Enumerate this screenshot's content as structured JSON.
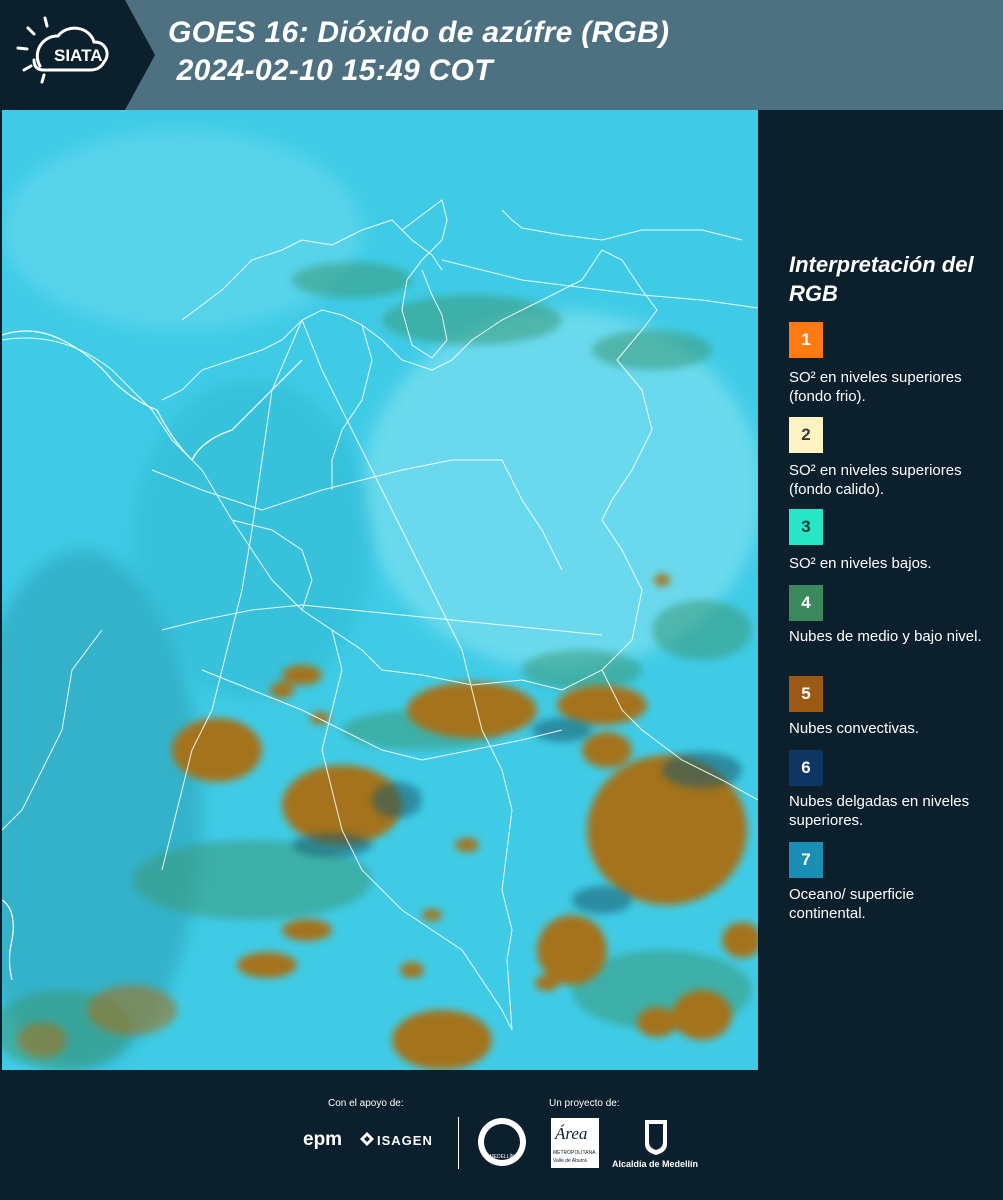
{
  "header": {
    "logo_text": "SIATA",
    "title": "GOES 16: Dióxido de azúfre (RGB)\n 2024-02-10 15:49 COT"
  },
  "map": {
    "description_icon": "satellite-rgb-map"
  },
  "legend": {
    "title": "Interpretación del RGB",
    "items": [
      {
        "number": "1",
        "label": "SO² en niveles superiores (fondo frio).",
        "color": "#ff7a12",
        "text_color": "#ffffff"
      },
      {
        "number": "2",
        "label": "SO² en niveles superiores (fondo calido).",
        "color": "#fdf3c2",
        "text_color": "#3a3a3a"
      },
      {
        "number": "3",
        "label": "SO² en niveles bajos.",
        "color": "#27e6c6",
        "text_color": "#0b3b3b"
      },
      {
        "number": "4",
        "label": "Nubes de medio y bajo nivel.",
        "color": "#3a8a5e",
        "text_color": "#ffffff"
      },
      {
        "number": "5",
        "label": "Nubes convectivas.",
        "color": "#9a5a16",
        "text_color": "#ffffff"
      },
      {
        "number": "6",
        "label": "Nubes delgadas en niveles superiores.",
        "color": "#0f3563",
        "text_color": "#ffffff"
      },
      {
        "number": "7",
        "label": "Oceano/ superficie continental.",
        "color": "#1a8fb5",
        "text_color": "#ffffff"
      }
    ]
  },
  "footer": {
    "support_label": "Con el apoyo de:",
    "project_label": "Un proyecto de:",
    "brand_epm": "epm",
    "brand_isagen": "ISAGEN",
    "brand_area_word": "Área",
    "brand_area_sub1": "METROPOLITANA",
    "brand_area_sub2": "Valle de Aburrá",
    "brand_alcaldia": "Alcaldía de Medellín",
    "seal_text": "MEDELLÍN"
  }
}
